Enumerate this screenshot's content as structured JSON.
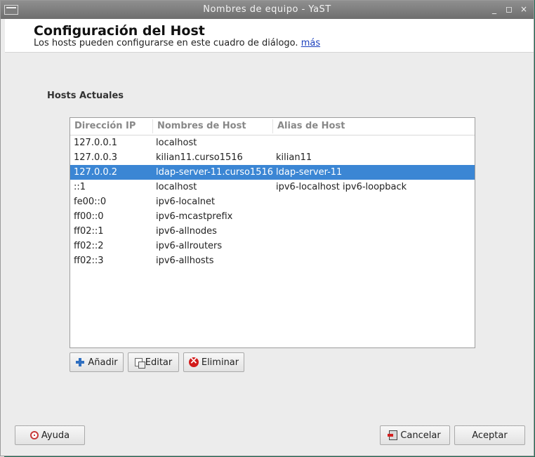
{
  "window": {
    "title": "Nombres de equipo - YaST"
  },
  "titlebar_buttons": [
    "_",
    "◻",
    "×"
  ],
  "header": {
    "title": "Configuración del Host",
    "subtitle": "Los hosts pueden configurarse en este cuadro de diálogo.",
    "more_link": "más"
  },
  "section_label": "Hosts Actuales",
  "table": {
    "columns": [
      "Dirección IP",
      "Nombres de Host",
      "Alias de Host"
    ],
    "rows": [
      {
        "ip": "127.0.0.1",
        "host": "localhost",
        "alias": ""
      },
      {
        "ip": "127.0.0.3",
        "host": "kilian11.curso1516",
        "alias": "kilian11"
      },
      {
        "ip": "127.0.0.2",
        "host": "ldap-server-11.curso1516",
        "alias": "ldap-server-11"
      },
      {
        "ip": "::1",
        "host": "localhost",
        "alias": "ipv6-localhost ipv6-loopback"
      },
      {
        "ip": "fe00::0",
        "host": "ipv6-localnet",
        "alias": ""
      },
      {
        "ip": "ff00::0",
        "host": "ipv6-mcastprefix",
        "alias": ""
      },
      {
        "ip": "ff02::1",
        "host": "ipv6-allnodes",
        "alias": ""
      },
      {
        "ip": "ff02::2",
        "host": "ipv6-allrouters",
        "alias": ""
      },
      {
        "ip": "ff02::3",
        "host": "ipv6-allhosts",
        "alias": ""
      }
    ],
    "selected_index": 2
  },
  "buttons": {
    "add": "Añadir",
    "edit": "Editar",
    "delete": "Eliminar",
    "help": "Ayuda",
    "cancel": "Cancelar",
    "accept": "Aceptar"
  },
  "colors": {
    "selection": "#3b86d4",
    "link": "#1a3fbd"
  }
}
